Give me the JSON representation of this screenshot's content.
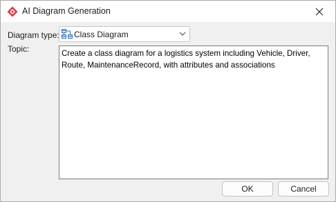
{
  "window": {
    "title": "AI Diagram Generation",
    "icon": "app-diamond-icon",
    "close_icon": "close-icon"
  },
  "form": {
    "diagram_type_label": "Diagram type:",
    "diagram_type_value": "Class Diagram",
    "diagram_type_icon": "class-diagram-icon",
    "topic_label": "Topic:",
    "topic_value": "Create a class diagram for a logistics system including Vehicle, Driver, Route, MaintenanceRecord, with attributes and associations"
  },
  "buttons": {
    "ok_label": "OK",
    "cancel_label": "Cancel"
  },
  "colors": {
    "accent_red": "#d9363e",
    "diagram_icon_blue": "#2f6fb7"
  }
}
